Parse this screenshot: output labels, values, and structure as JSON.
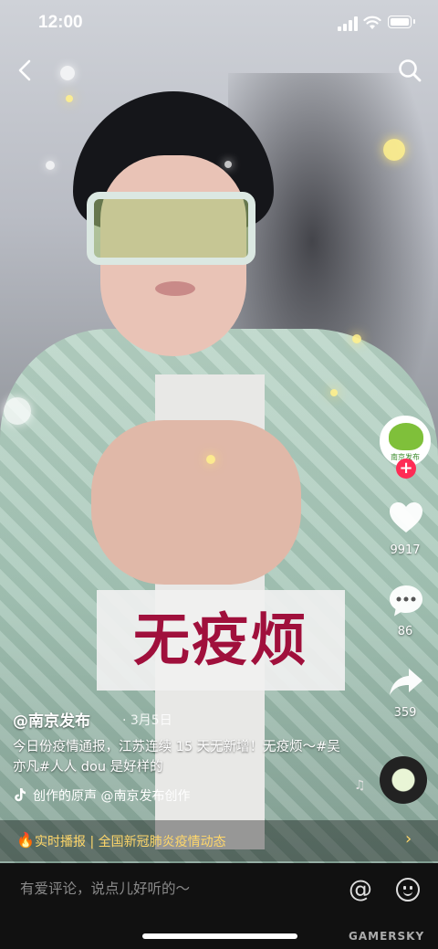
{
  "status_bar": {
    "time": "12:00"
  },
  "video": {
    "caption_card": "无疫烦"
  },
  "rail": {
    "avatar_label": "南京发布",
    "likes": "9917",
    "comments": "86",
    "shares": "359"
  },
  "post": {
    "author": "@南京发布",
    "date": "· 3月5日",
    "description": "今日份疫情通报，江苏连续 15 天无新增！无疫烦～#吴亦凡#人人 dou 是好样的",
    "music": "创作的原声    @南京发布创作"
  },
  "banner": {
    "label": "实时播报 | 全国新冠肺炎疫情动态"
  },
  "comment_bar": {
    "placeholder": "有爱评论，说点儿好听的～",
    "at_symbol": "@"
  },
  "watermark": "GAMERSKY",
  "colors": {
    "accent": "#fe2c55",
    "caption": "#a0103c",
    "banner_text": "#ffd76a"
  }
}
